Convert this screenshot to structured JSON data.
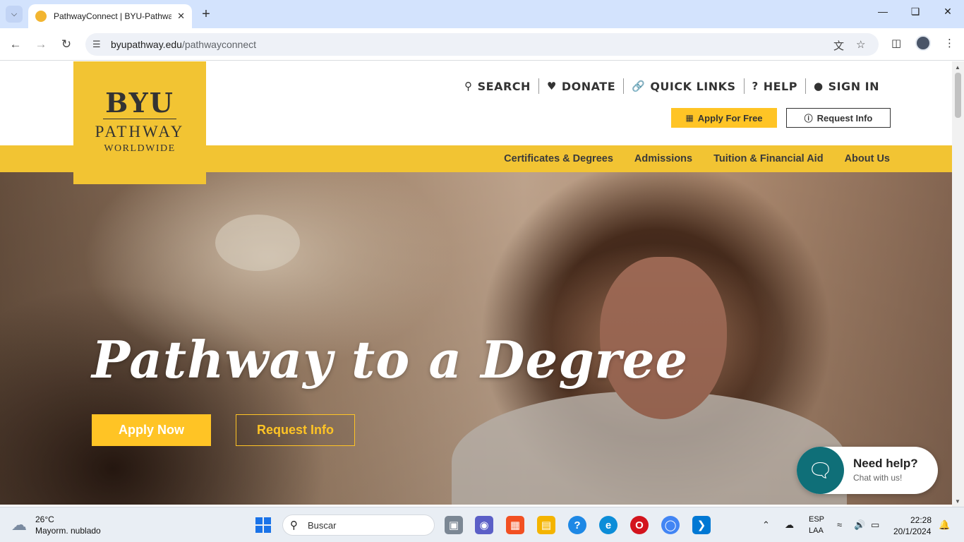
{
  "browser": {
    "tab_title": "PathwayConnect | BYU-Pathway",
    "url_domain": "byupathway.edu",
    "url_path": "/pathwayconnect"
  },
  "site": {
    "logo": {
      "line1": "BYU",
      "line2": "PATHWAY",
      "line3": "WORLDWIDE"
    },
    "utility_nav": [
      {
        "label": "SEARCH",
        "icon": "search-icon"
      },
      {
        "label": "DONATE",
        "icon": "heart-icon"
      },
      {
        "label": "QUICK LINKS",
        "icon": "link-icon"
      },
      {
        "label": "HELP",
        "icon": "question-icon"
      },
      {
        "label": "SIGN IN",
        "icon": "user-icon"
      }
    ],
    "apply_free_label": "Apply For Free",
    "request_info_label": "Request Info",
    "main_nav": [
      "Certificates & Degrees",
      "Admissions",
      "Tuition & Financial Aid",
      "About Us"
    ],
    "hero": {
      "title": "Pathway to a Degree",
      "apply_now": "Apply Now",
      "request_info": "Request Info"
    },
    "chat": {
      "title": "Need help?",
      "subtitle": "Chat with us!"
    },
    "colors": {
      "brand_gold": "#ffc425",
      "nav_gold": "#f2c433",
      "chat_teal": "#0f6f78"
    }
  },
  "taskbar": {
    "weather_temp": "26°C",
    "weather_desc": "Mayorm. nublado",
    "search_placeholder": "Buscar",
    "lang_line1": "ESP",
    "lang_line2": "LAA",
    "time": "22:28",
    "date": "20/1/2024"
  }
}
